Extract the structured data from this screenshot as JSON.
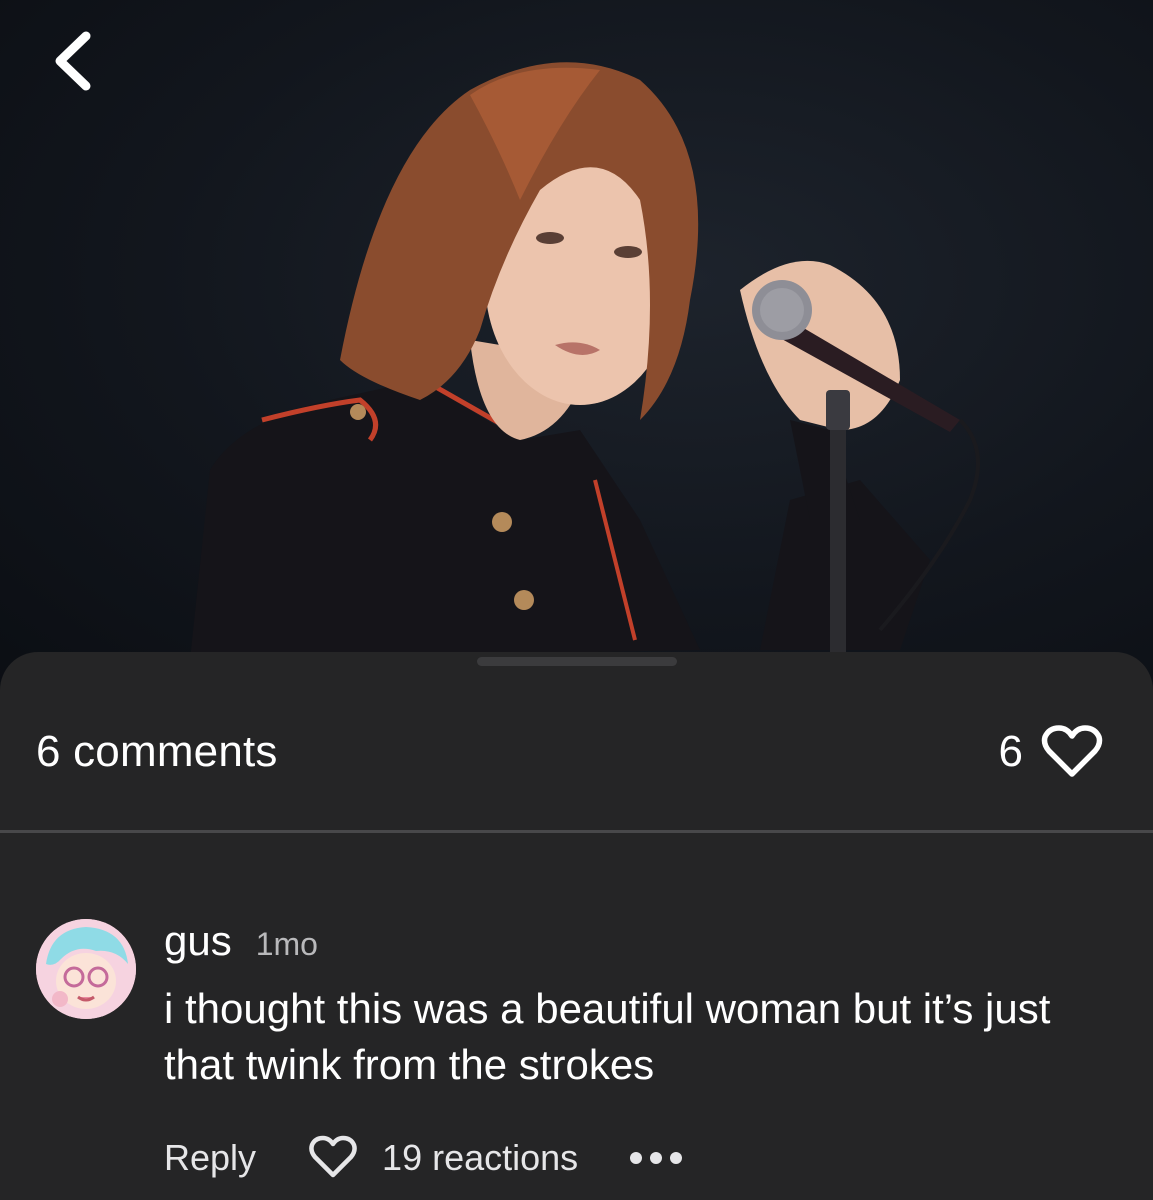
{
  "post": {
    "photo_alt": "Singer with shoulder-length hair holding a microphone on stage"
  },
  "sheet": {
    "comments_count": "6 comments",
    "likes_count": "6"
  },
  "comments": [
    {
      "username": "gus",
      "timestamp": "1mo",
      "text": "i thought this was a beautiful woman but it’s just that twink from the strokes",
      "reply_label": "Reply",
      "reactions": "19 reactions"
    }
  ],
  "icons": {
    "back": "chevron-left-icon",
    "like": "heart-outline-icon",
    "more": "ellipsis-icon"
  },
  "colors": {
    "sheet_bg": "#252526",
    "text": "#ffffff",
    "muted": "#b9b9bb"
  }
}
